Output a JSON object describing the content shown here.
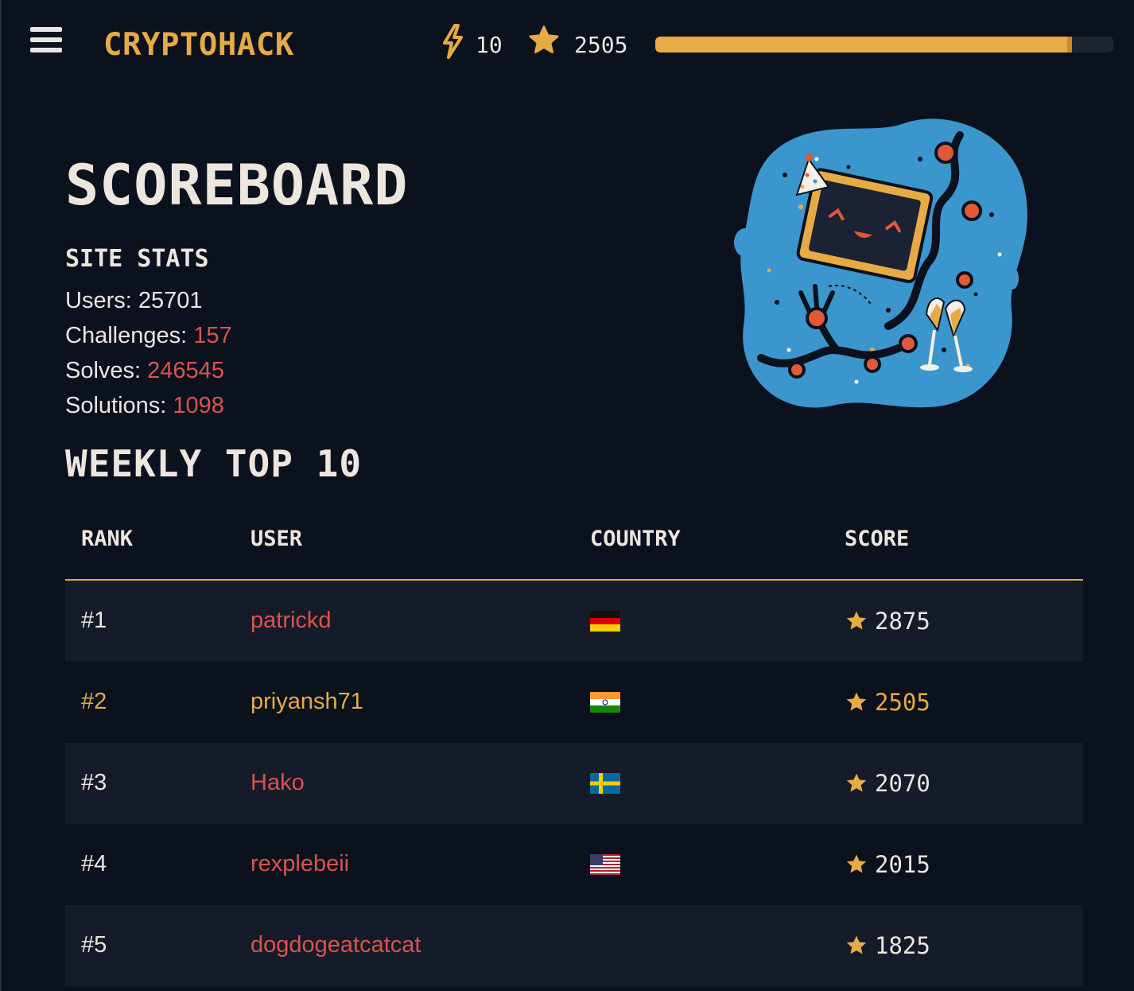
{
  "header": {
    "brand": "CRYPTOHACK",
    "streak": "10",
    "score": "2505",
    "progress_fraction": 0.91,
    "accent": "#e6ab45"
  },
  "page": {
    "title": "SCOREBOARD",
    "stats_heading": "SITE STATS",
    "stats": [
      {
        "label": "Users:",
        "value": "25701"
      },
      {
        "label": "Challenges:",
        "value": "157"
      },
      {
        "label": "Solves:",
        "value": "246545"
      },
      {
        "label": "Solutions:",
        "value": "1098"
      }
    ],
    "weekly_heading": "WEEKLY TOP 10"
  },
  "table": {
    "columns": [
      "RANK",
      "USER",
      "COUNTRY",
      "SCORE"
    ],
    "rows": [
      {
        "rank": "#1",
        "user": "patrickd",
        "country": "germany-flag",
        "score": "2875"
      },
      {
        "rank": "#2",
        "user": "priyansh71",
        "country": "india-flag",
        "score": "2505"
      },
      {
        "rank": "#3",
        "user": "Hako",
        "country": "sweden-flag",
        "score": "2070"
      },
      {
        "rank": "#4",
        "user": "rexplebeii",
        "country": "usa-flag",
        "score": "2015"
      },
      {
        "rank": "#5",
        "user": "dogdogeatcatcat",
        "country": "",
        "score": "1825"
      }
    ]
  },
  "colors": {
    "background": "#0c111e",
    "link": "#d9534f",
    "gold": "#e6ab45",
    "text": "#ece6df"
  }
}
